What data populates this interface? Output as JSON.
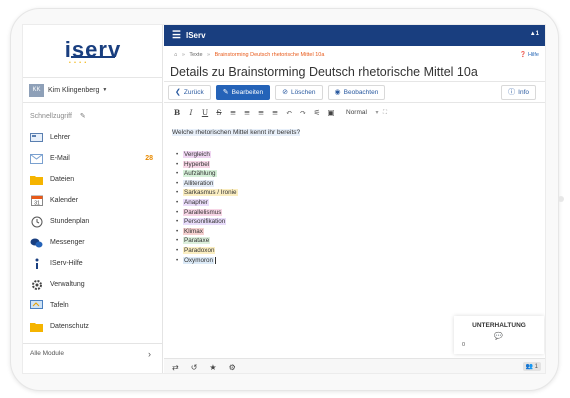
{
  "brand": {
    "logo": "iserv",
    "accent": "#193e7f",
    "link_color": "#2563b8",
    "highlight_color": "#e85a1a"
  },
  "user": {
    "initials": "KK",
    "name": "Kim Klingenberg"
  },
  "sidebar": {
    "quick_access": "Schnellzugriff",
    "items": [
      {
        "label": "Lehrer",
        "icon": "teacher-icon",
        "badge": ""
      },
      {
        "label": "E-Mail",
        "icon": "mail-icon",
        "badge": "28"
      },
      {
        "label": "Dateien",
        "icon": "folder-icon",
        "badge": ""
      },
      {
        "label": "Kalender",
        "icon": "calendar-icon",
        "badge": ""
      },
      {
        "label": "Stundenplan",
        "icon": "clock-icon",
        "badge": ""
      },
      {
        "label": "Messenger",
        "icon": "chat-icon",
        "badge": ""
      },
      {
        "label": "IServ-Hilfe",
        "icon": "help-icon",
        "badge": ""
      },
      {
        "label": "Verwaltung",
        "icon": "gear-icon",
        "badge": ""
      },
      {
        "label": "Tafeln",
        "icon": "board-icon",
        "badge": ""
      },
      {
        "label": "Datenschutz",
        "icon": "folder-icon",
        "badge": ""
      }
    ],
    "all_modules": "Alle Module"
  },
  "topbar": {
    "title": "IServ",
    "right": "▲1"
  },
  "breadcrumb": {
    "home": "⌂",
    "parent": "Texte",
    "current": "Brainstorming Deutsch rhetorische Mittel 10a"
  },
  "help_label": "Hilfe",
  "page_title": "Details zu Brainstorming Deutsch rhetorische Mittel 10a",
  "actions": {
    "back": "Zurück",
    "edit": "Bearbeiten",
    "delete": "Löschen",
    "watch": "Beobachten",
    "info": "Info"
  },
  "toolbar": {
    "buttons": [
      "B",
      "I",
      "U",
      "S",
      "≡",
      "≡",
      "≡",
      "≡",
      "↶",
      "↷",
      "⚟",
      "▣"
    ],
    "format": "Normal"
  },
  "document": {
    "question": "Welche rhetorischen Mittel kennt ihr bereits?",
    "items": [
      {
        "text": "Vergleich",
        "color": "#f0d6f2"
      },
      {
        "text": "Hyperbel",
        "color": "#f7d6e6"
      },
      {
        "text": "Aufzählung",
        "color": "#d5f0d8"
      },
      {
        "text": "Alliteration",
        "color": "#e4ecf7"
      },
      {
        "text": "Sarkasmus / Ironie",
        "color": "#fbeec1"
      },
      {
        "text": "Anapher",
        "color": "#eadcfa"
      },
      {
        "text": "Parallelismus",
        "color": "#f7d6e6"
      },
      {
        "text": "Personifikation",
        "color": "#e8dcfa"
      },
      {
        "text": "Klimax",
        "color": "#f5d0d0"
      },
      {
        "text": "Parataxe",
        "color": "#dcefdc"
      },
      {
        "text": "Paradoxon",
        "color": "#fbeec1"
      },
      {
        "text": "Oxymoron",
        "color": "#dceaf7"
      }
    ]
  },
  "chat": {
    "title": "UNTERHALTUNG",
    "count": "0"
  },
  "bottombar": {
    "users": "1"
  }
}
